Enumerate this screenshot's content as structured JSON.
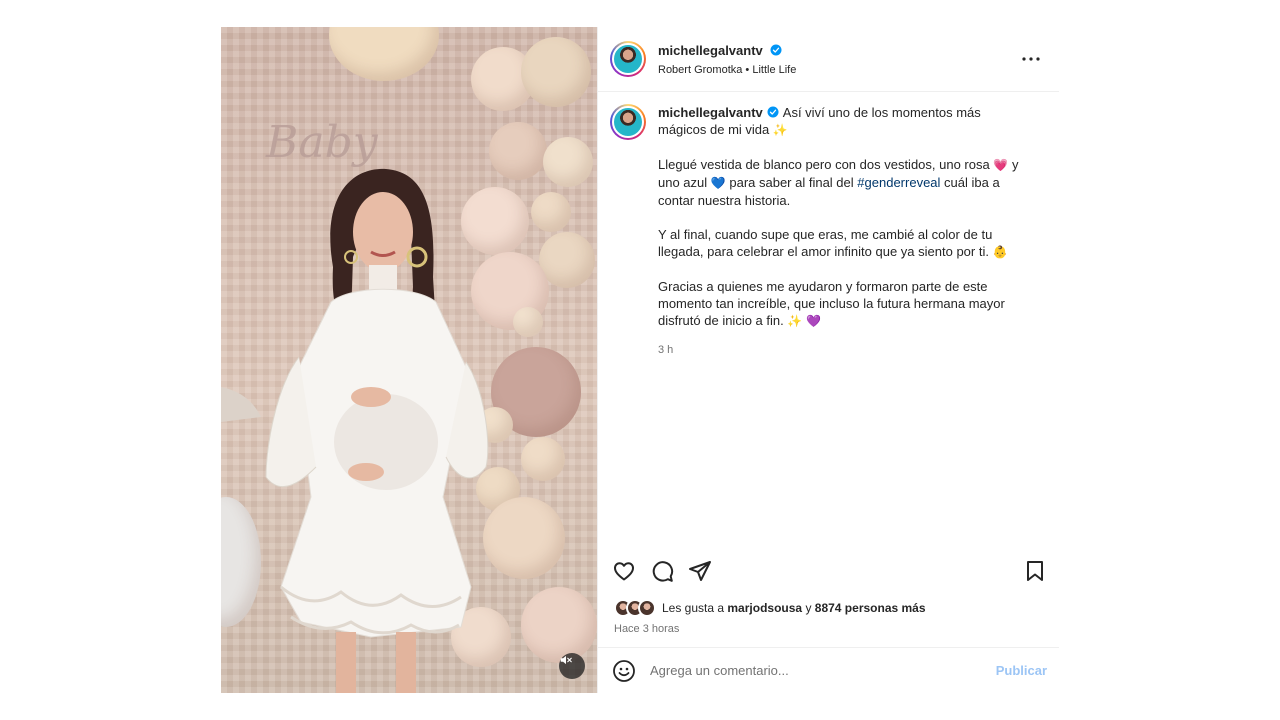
{
  "post": {
    "username": "michellegalvantv",
    "audio": "Robert Gromotka • Little Life",
    "more_icon": "more-options-icon",
    "caption": {
      "line1": "Así viví uno de los momentos más mágicos de mi vida",
      "p2a": "Llegué vestida de blanco pero con dos vestidos, uno rosa",
      "p2b": "y uno azul",
      "p2c": "para saber al final del",
      "hashtag": "#genderreveal",
      "p2d": "cuál iba a contar nuestra historia.",
      "p3": "Y al final, cuando supe que eras, me cambié al color de tu llegada, para celebrar el amor infinito que ya siento por ti.",
      "p4": "Gracias a quienes me ayudaron y formaron parte de este momento tan increíble, que incluso la futura hermana mayor disfrutó de inicio a fin."
    },
    "caption_time": "3 h",
    "likes": {
      "prefix": "Les gusta a",
      "user": "marjodsousa",
      "connector": "y",
      "others": "8874 personas más"
    },
    "posted_ago": "Hace 3 horas",
    "comment_placeholder": "Agrega un comentario...",
    "publish_label": "Publicar"
  },
  "colors": {
    "verified": "#0095f6",
    "hashtag": "#00376b",
    "publish": "#9cc5f5"
  }
}
